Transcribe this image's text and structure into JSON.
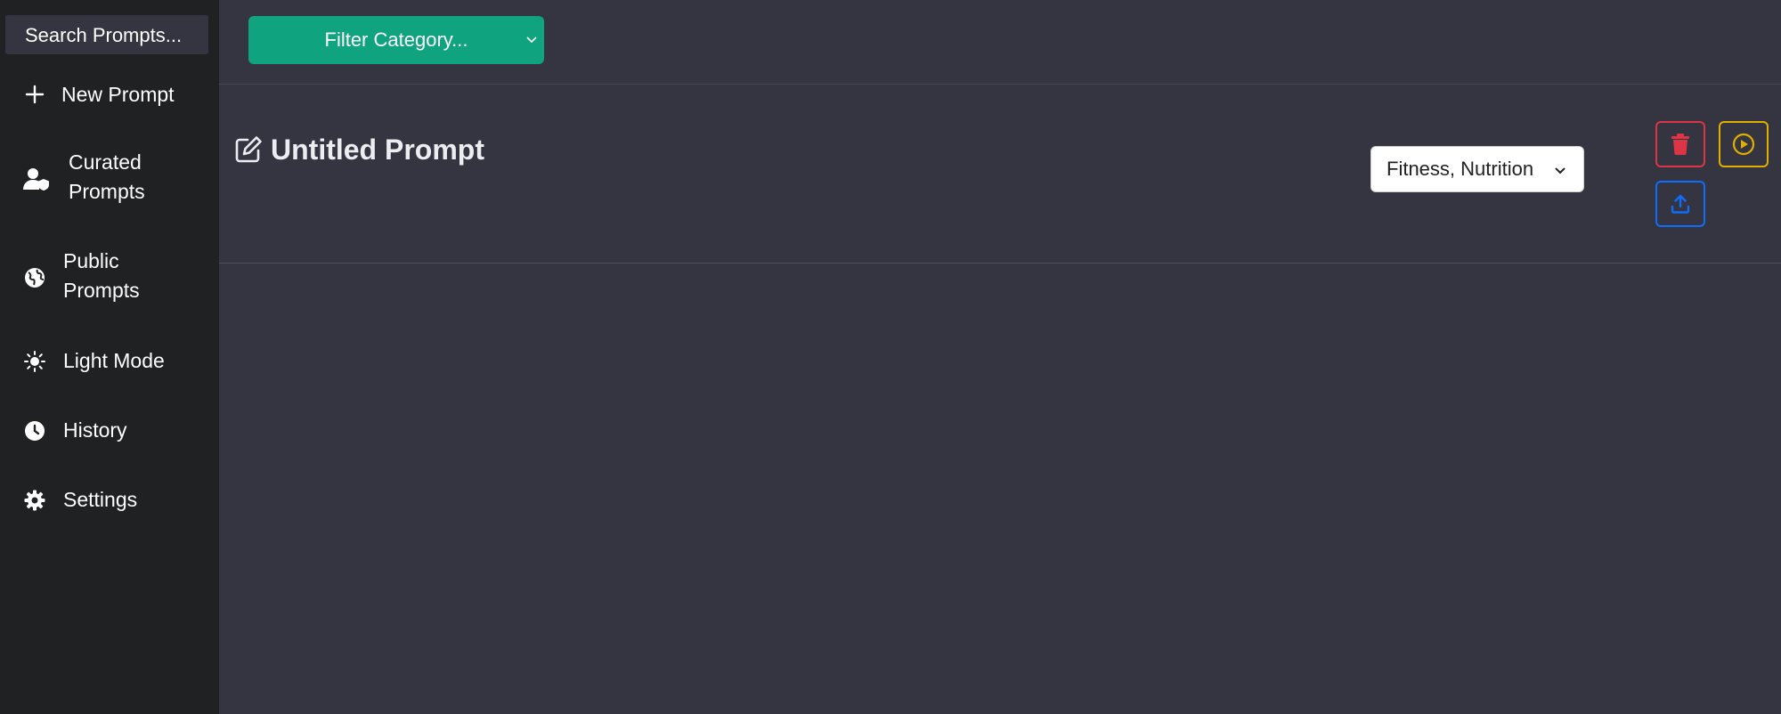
{
  "sidebar": {
    "search_placeholder": "Search Prompts...",
    "items": [
      {
        "label": "New Prompt",
        "icon": "plus-icon"
      },
      {
        "label": "Curated Prompts",
        "icon": "user-shield-icon"
      },
      {
        "label": "Public Prompts",
        "icon": "globe-icon"
      },
      {
        "label": "Light Mode",
        "icon": "sun-icon"
      },
      {
        "label": "History",
        "icon": "clock-icon"
      },
      {
        "label": "Settings",
        "icon": "gear-icon"
      }
    ]
  },
  "toolbar": {
    "filter_label": "Filter Category..."
  },
  "prompt": {
    "title": "Untitled Prompt",
    "category_value": "Fitness, Nutrition"
  },
  "actions": {
    "delete_icon": "trash-icon",
    "run_icon": "play-circle-icon",
    "share_icon": "upload-icon"
  },
  "colors": {
    "sidebar_bg": "#202123",
    "main_bg": "#343541",
    "accent_green": "#10a37f",
    "danger": "#dc3545",
    "warning": "#e0b000",
    "primary": "#0d6efd"
  }
}
